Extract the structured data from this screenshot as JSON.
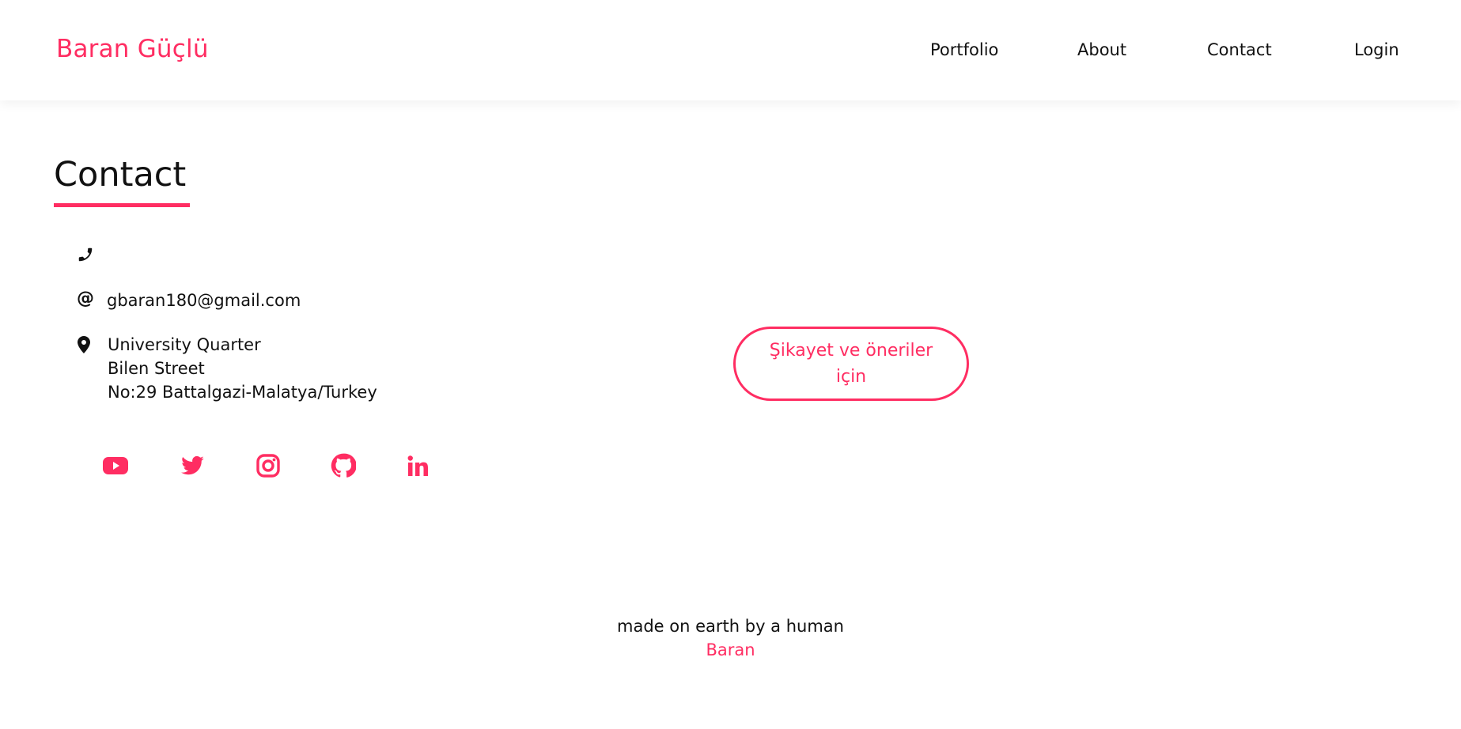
{
  "header": {
    "brand": "Baran Güçlü",
    "nav": [
      "Portfolio",
      "About",
      "Contact",
      "Login"
    ]
  },
  "main": {
    "title": "Contact",
    "phone": "",
    "email": "gbaran180@gmail.com",
    "address": [
      "University Quarter",
      "Bilen Street",
      "No:29 Battalgazi-Malatya/Turkey"
    ],
    "cta_label": "Şikayet ve öneriler için",
    "socials": [
      "youtube-icon",
      "twitter-icon",
      "instagram-icon",
      "github-icon",
      "linkedin-icon"
    ]
  },
  "footer": {
    "line1": "made on earth by a human",
    "line2": "Baran"
  },
  "colors": {
    "accent": "#ff2d62",
    "text": "#111111",
    "background": "#ffffff"
  }
}
